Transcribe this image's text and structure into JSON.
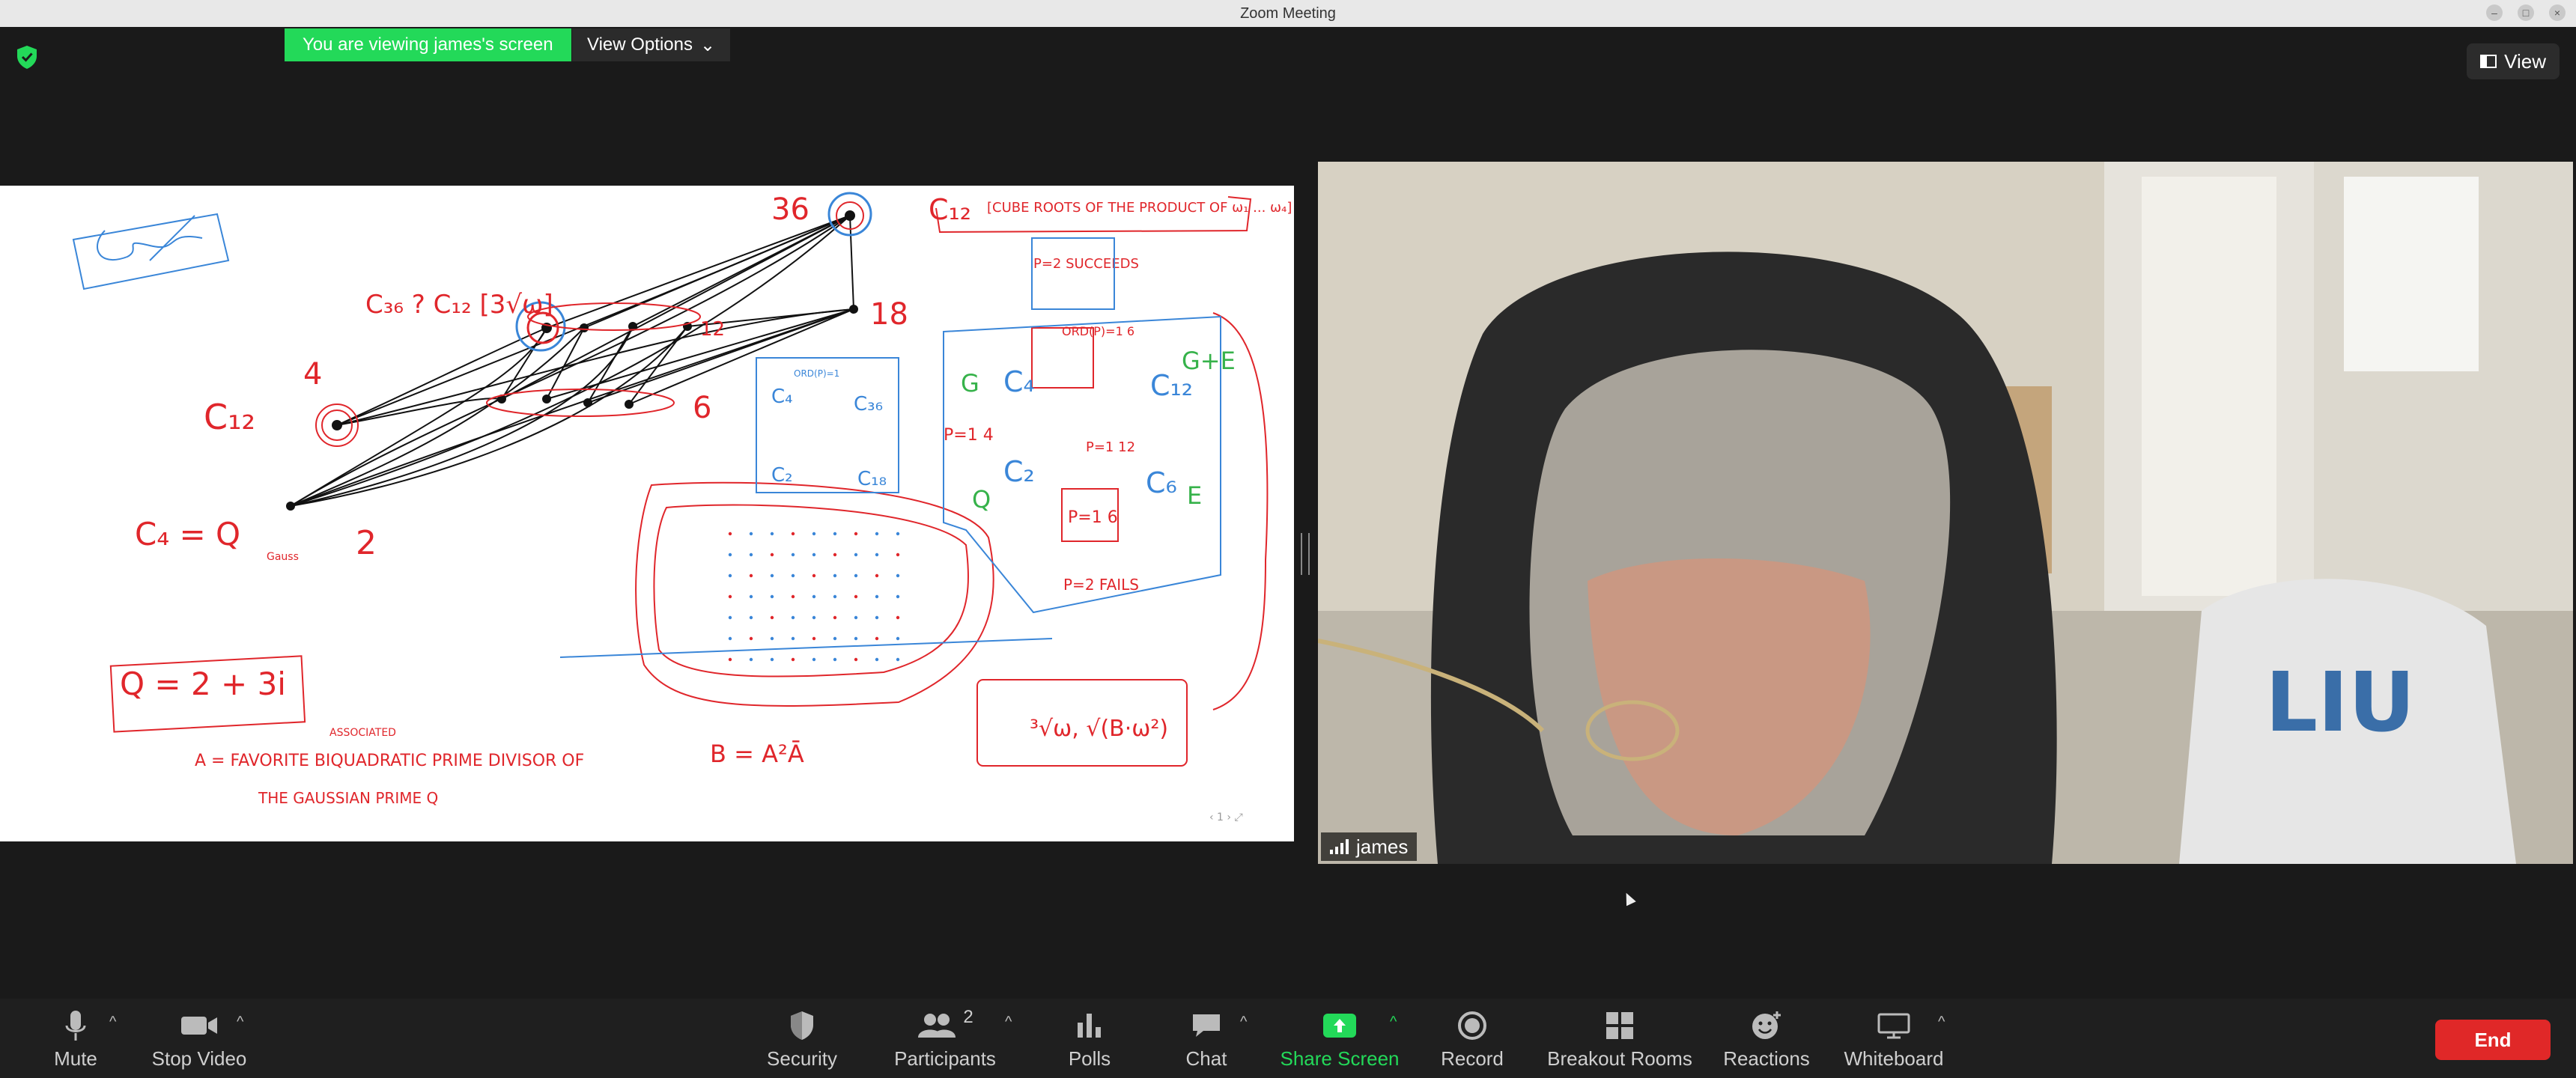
{
  "window": {
    "title": "Zoom Meeting"
  },
  "banner": {
    "viewing_text": "You are viewing james's screen",
    "view_options": "View Options"
  },
  "top_right": {
    "view_label": "View"
  },
  "video": {
    "participant_name": "james",
    "shirt_text": "LIU"
  },
  "whiteboard": {
    "labels": {
      "c12_top": "C₁₂",
      "c36_eq": "C₃₆ ? C₁₂ [3√ω]",
      "c12_left": "C₁₂",
      "c4_left": "C₄ = Q",
      "gauss": "Gauss",
      "num_36": "36",
      "num_18": "18",
      "num_12": "12",
      "num_6": "6",
      "num_4": "4",
      "num_2": "2",
      "cube_roots": "[CUBE ROOTS OF THE PRODUCT OF ω₁ ... ω₄]",
      "q_eq": "Q = 2 + 3i",
      "a_eq": "A = FAVORITE BIQUADRATIC PRIME DIVISOR OF",
      "a_eq2": "THE GAUSSIAN PRIME Q",
      "a_note": "ASSOCIATED",
      "b_eq": "B = A²Ā",
      "sqrt_expr": "³√ω, √(B·ω²)",
      "p_eq_2_succeeds": "P=2 SUCCEEDS",
      "p_eq_1_4": "P=1 4",
      "p_eq_1_6": "P=1 6",
      "p_eq_1_12": "P=1 12",
      "p_eq_2_fails": "P=2 FAILS",
      "ord_1": "ORD(P)=1 6",
      "c4": "C₄",
      "c36": "C₃₆",
      "c2": "C₂",
      "c18": "C₁₈",
      "c4b": "C₄",
      "c12b": "C₁₂",
      "c2b": "C₂",
      "c6b": "C₆",
      "g": "G",
      "g_plus_e": "G+E",
      "e": "E",
      "q": "Q",
      "ord_small": "ORD(P)=1"
    }
  },
  "toolbar": {
    "mute": "Mute",
    "stop_video": "Stop Video",
    "security": "Security",
    "participants": "Participants",
    "participants_count": "2",
    "polls": "Polls",
    "chat": "Chat",
    "share_screen": "Share Screen",
    "record": "Record",
    "breakout": "Breakout Rooms",
    "reactions": "Reactions",
    "whiteboard": "Whiteboard",
    "end": "End"
  },
  "colors": {
    "green": "#23d959",
    "end_red": "#e02828",
    "ink_red": "#e0262b",
    "ink_blue": "#3a86d8",
    "ink_black": "#111111",
    "ink_green": "#36b24a"
  }
}
